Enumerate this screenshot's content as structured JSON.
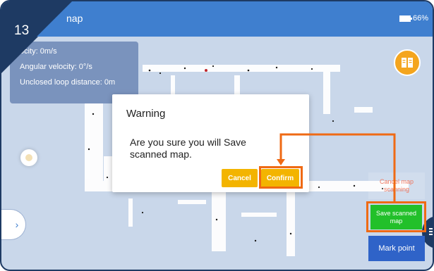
{
  "step_number": "13",
  "header": {
    "title": "nap",
    "battery_text": "66%"
  },
  "info_panel": {
    "lines": [
      "ocity: 0m/s",
      "Angular velocity: 0°/s",
      "Unclosed loop distance: 0m"
    ]
  },
  "dialog": {
    "title": "Warning",
    "message": "Are you sure you will Save scanned map.",
    "cancel_label": "Cancel",
    "confirm_label": "Confirm"
  },
  "side_buttons": {
    "cancel_map_scanning": "Cancel map scanning",
    "save_scanned_map": "Save scanned map",
    "mark_point": "Mark point"
  },
  "colors": {
    "header_blue": "#3f7fcf",
    "navy": "#1e3a63",
    "highlight_orange": "#ef6a14",
    "button_yellow": "#f3b400",
    "save_green": "#22c02a",
    "mark_blue": "#2f63c8",
    "book_orange": "#f4a51e"
  },
  "icons": [
    "book-icon",
    "battery-icon",
    "chevron-right-icon",
    "menu-icon"
  ]
}
